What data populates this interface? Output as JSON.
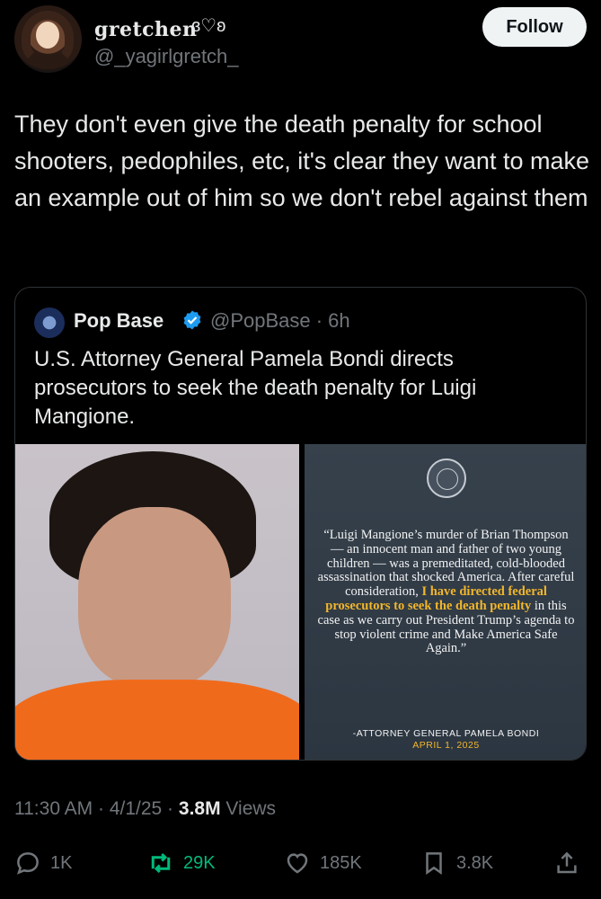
{
  "author": {
    "display_name": "gretchen",
    "name_decoration": "ɞ♡ʚ",
    "handle": "@_yagirlgretch_"
  },
  "follow_label": "Follow",
  "tweet": {
    "text": "They don't even give the death penalty for school shooters, pedophiles, etc, it's clear they want to make an example out of him so we don't rebel against them"
  },
  "quoted": {
    "name": "Pop Base",
    "handle_time": "@PopBase · 6h",
    "text": "U.S. Attorney General Pamela Bondi directs prosecutors to seek the death penalty for Luigi Mangione.",
    "statement": {
      "part1": "“Luigi Mangione’s murder of Brian Thompson — an innocent man and father of two young children — was a premeditated, cold-blooded assassination that shocked America. After careful consideration, ",
      "highlight": "I have directed federal prosecutors to seek the death penalty",
      "part2": " in this case as we carry out President Trump’s agenda to stop violent crime and Make America Safe Again.”",
      "attribution": "-ATTORNEY GENERAL PAMELA BONDI",
      "date": "APRIL 1, 2025"
    }
  },
  "meta": {
    "time_date": "11:30 AM · 4/1/25 · ",
    "views_count": "3.8M",
    "views_label": " Views"
  },
  "actions": {
    "replies": "1K",
    "reposts": "29K",
    "likes": "185K",
    "bookmarks": "3.8K"
  },
  "colors": {
    "background": "#000000",
    "text": "#e7e9ea",
    "muted": "#71767b",
    "repost_green": "#00ba7c",
    "verified_blue": "#1d9bf0",
    "highlight_gold": "#f2b62b",
    "jumpsuit_orange": "#f06a1c"
  },
  "icons": [
    "reply-icon",
    "repost-icon",
    "like-icon",
    "bookmark-icon",
    "share-icon",
    "verified-badge-icon",
    "doj-seal-icon"
  ]
}
